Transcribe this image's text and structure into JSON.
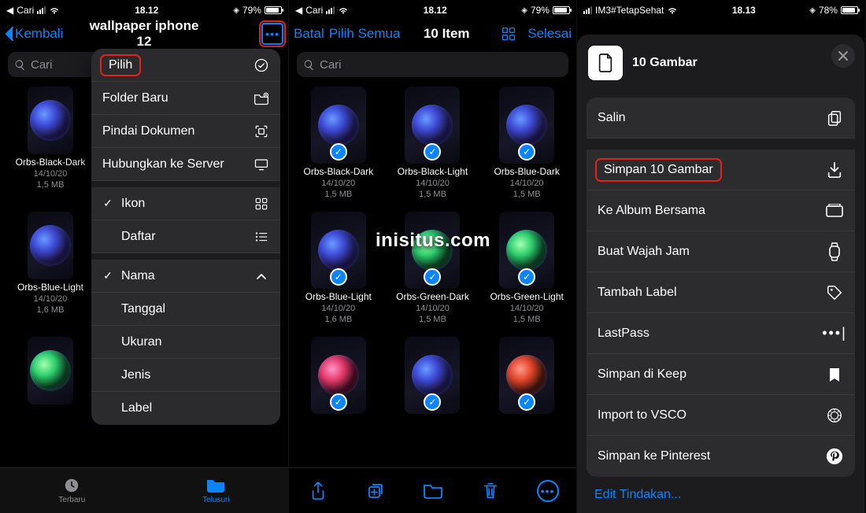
{
  "watermark": "inisitus.com",
  "phone1": {
    "status": {
      "left_text": "Cari",
      "time": "18.12",
      "batt": "79%"
    },
    "nav": {
      "back": "Kembali",
      "title": "wallpaper iphone 12"
    },
    "search_placeholder": "Cari",
    "popover": {
      "select": "Pilih",
      "new_folder": "Folder Baru",
      "scan": "Pindai Dokumen",
      "connect": "Hubungkan ke Server",
      "view_icon": "Ikon",
      "view_list": "Daftar",
      "sort_name": "Nama",
      "sort_date": "Tanggal",
      "sort_size": "Ukuran",
      "sort_kind": "Jenis",
      "sort_tag": "Label"
    },
    "side_cells": [
      {
        "name": "Orbs-Black-Dark",
        "date": "14/10/20",
        "size": "1,5 MB"
      },
      {
        "name": "Orbs-Blue-Light",
        "date": "14/10/20",
        "size": "1,6 MB"
      }
    ],
    "tabs": {
      "recent": "Terbaru",
      "browse": "Telusuri"
    }
  },
  "phone2": {
    "status": {
      "left_text": "Cari",
      "time": "18.12",
      "batt": "79%"
    },
    "nav": {
      "cancel": "Batal",
      "select_all": "Pilih Semua",
      "count": "10 Item",
      "done": "Selesai"
    },
    "search_placeholder": "Cari",
    "cells": [
      {
        "name": "Orbs-Black-Dark",
        "date": "14/10/20",
        "size": "1,5 MB",
        "orb": ""
      },
      {
        "name": "Orbs-Black-Light",
        "date": "14/10/20",
        "size": "1,5 MB",
        "orb": ""
      },
      {
        "name": "Orbs-Blue-Dark",
        "date": "14/10/20",
        "size": "1,5 MB",
        "orb": ""
      },
      {
        "name": "Orbs-Blue-Light",
        "date": "14/10/20",
        "size": "1,6 MB",
        "orb": ""
      },
      {
        "name": "Orbs-Green-Dark",
        "date": "14/10/20",
        "size": "1,5 MB",
        "orb": "green"
      },
      {
        "name": "Orbs-Green-Light",
        "date": "14/10/20",
        "size": "1,5 MB",
        "orb": "green"
      },
      {
        "name": "",
        "date": "",
        "size": "",
        "orb": "pink"
      },
      {
        "name": "",
        "date": "",
        "size": "",
        "orb": ""
      },
      {
        "name": "",
        "date": "",
        "size": "",
        "orb": "red"
      }
    ]
  },
  "phone3": {
    "status": {
      "left_text": "IM3#TetapSehat",
      "time": "18.13",
      "batt": "78%"
    },
    "sheet": {
      "title": "10 Gambar",
      "rows": [
        {
          "label": "Salin",
          "icon": "copy"
        },
        {
          "label": "Simpan 10 Gambar",
          "icon": "download",
          "hl": true
        },
        {
          "label": "Ke Album Bersama",
          "icon": "shared-album"
        },
        {
          "label": "Buat Wajah Jam",
          "icon": "watch"
        },
        {
          "label": "Tambah Label",
          "icon": "tag"
        },
        {
          "label": "LastPass",
          "icon": "dots"
        },
        {
          "label": "Simpan di Keep",
          "icon": "bookmark"
        },
        {
          "label": "Import to VSCO",
          "icon": "vsco"
        },
        {
          "label": "Simpan ke Pinterest",
          "icon": "pinterest"
        }
      ],
      "edit": "Edit Tindakan..."
    }
  }
}
